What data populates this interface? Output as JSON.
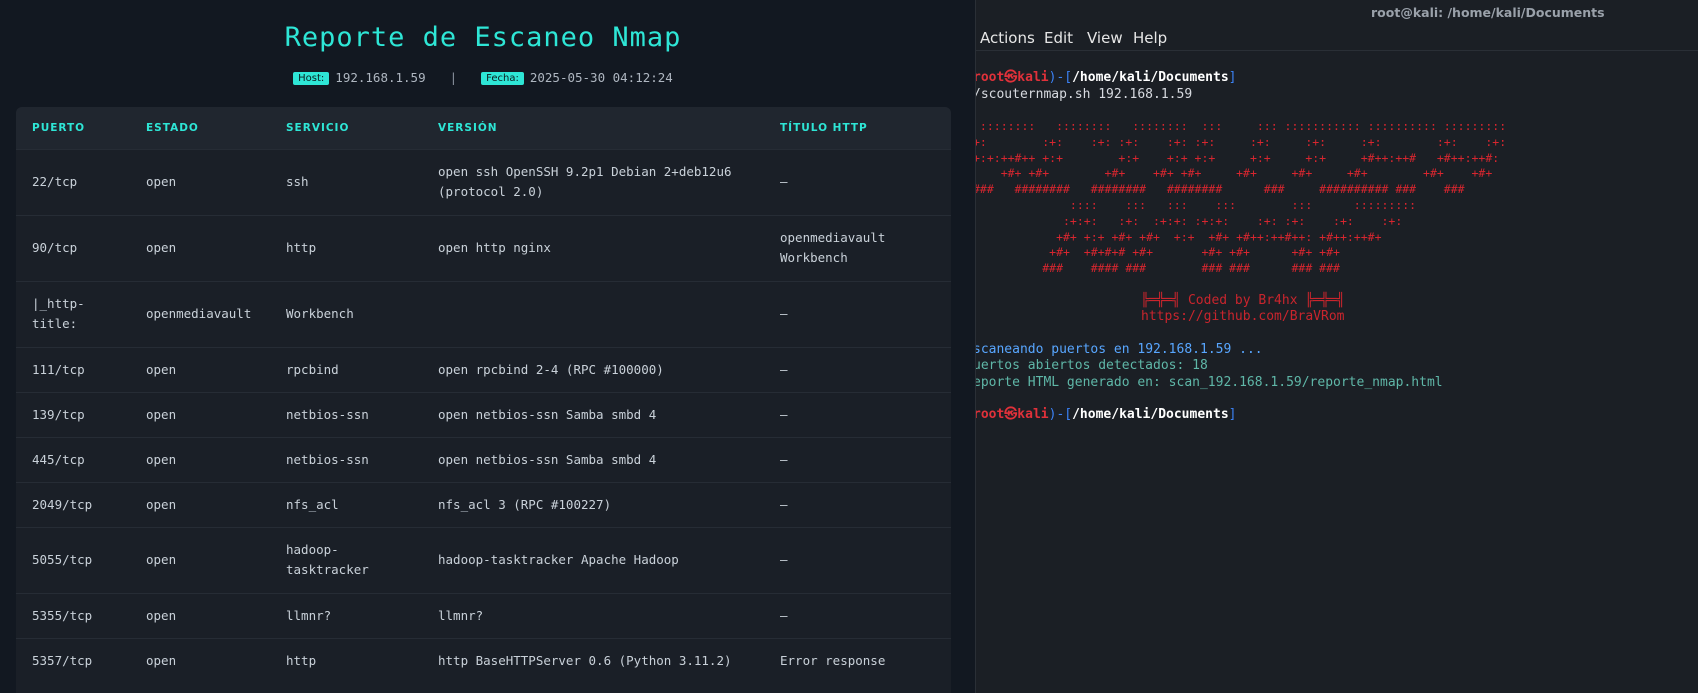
{
  "report": {
    "title": "Reporte de Escaneo Nmap",
    "host_label": "Host:",
    "host": "192.168.1.59",
    "separator": "|",
    "date_label": "Fecha:",
    "date": "2025-05-30 04:12:24",
    "columns": [
      "PUERTO",
      "ESTADO",
      "SERVICIO",
      "VERSIÓN",
      "TÍTULO HTTP"
    ],
    "rows": [
      [
        "22/tcp",
        "open",
        "ssh",
        "open ssh OpenSSH 9.2p1 Debian 2+deb12u6 (protocol 2.0)",
        "—"
      ],
      [
        "90/tcp",
        "open",
        "http",
        "open http nginx",
        "openmediavault Workbench"
      ],
      [
        "|_http-title:",
        "openmediavault",
        "Workbench",
        "",
        "—"
      ],
      [
        "111/tcp",
        "open",
        "rpcbind",
        "open rpcbind 2-4 (RPC #100000)",
        "—"
      ],
      [
        "139/tcp",
        "open",
        "netbios-ssn",
        "open netbios-ssn Samba smbd 4",
        "—"
      ],
      [
        "445/tcp",
        "open",
        "netbios-ssn",
        "open netbios-ssn Samba smbd 4",
        "—"
      ],
      [
        "2049/tcp",
        "open",
        "nfs_acl",
        "nfs_acl 3 (RPC #100227)",
        "—"
      ],
      [
        "5055/tcp",
        "open",
        "hadoop-tasktracker",
        "hadoop-tasktracker Apache Hadoop",
        "—"
      ],
      [
        "5355/tcp",
        "open",
        "llmnr?",
        "llmnr?",
        "—"
      ],
      [
        "5357/tcp",
        "open",
        "http",
        "http BaseHTTPServer 0.6 (Python 3.11.2)",
        "Error response"
      ]
    ]
  },
  "terminal": {
    "title": "root@kali: /home/kali/Documents",
    "menu": [
      "Actions",
      "Edit",
      "View",
      "Help"
    ],
    "prompt_user": "root㉿kali",
    "prompt_open": ")-[",
    "prompt_close": "]",
    "cwd": "/home/kali/Documents",
    "command": "/scouternmap.sh 192.168.1.59",
    "ascii_art": [
      " ::::::::   ::::::::   ::::::::  :::     ::: ::::::::::: :::::::::: ::::::::: ",
      "+:        :+:    :+: :+:    :+: :+:     :+:     :+:     :+:        :+:    :+: ",
      "+:+:++#++ +:+        +:+    +:+ +:+     +:+     +:+     +#++:++#   +#++:++#:  ",
      "    +#+ +#+        +#+    +#+ +#+     +#+     +#+     +#+        +#+    +#+   ",
      "###   ########   ########   ########      ###     ########## ###    ###       ",
      "              ::::    :::   :::    :::        :::      :::::::::              ",
      "             :+:+:   :+:  :+:+: :+:+:    :+: :+:    :+:    :+:                ",
      "            +#+ +:+ +#+ +#+  +:+  +#+ +#++:++#++: +#++:++#+                   ",
      "           +#+  +#+#+# +#+       +#+ +#+      +#+ +#+                         ",
      "          ###    #### ###        ### ###      ### ###                         "
    ],
    "banner_1": "╠═╬═╣ Coded by Br4hx ╠═╬═╣",
    "banner_2": "https://github.com/BraVRom",
    "scan_prefix": "scaneando puertos en ",
    "scan_host": "192.168.1.59",
    "scan_suffix": " ...",
    "ports_line": "uertos abiertos detectados: 18",
    "report_line": "eporte HTML generado en: scan_192.168.1.59/reporte_nmap.html"
  }
}
